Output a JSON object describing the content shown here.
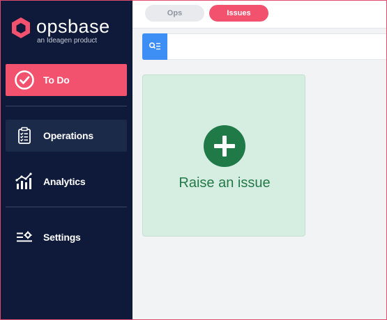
{
  "brand": {
    "name": "opsbase",
    "tagline": "an Ideagen product",
    "logo_icon": "hexagon-logo-icon",
    "accent": "#f2526e"
  },
  "sidebar": {
    "background": "#0f1a3a",
    "items": [
      {
        "label": "To Do",
        "icon": "check-circle-icon",
        "active": true
      },
      {
        "label": "Operations",
        "icon": "clipboard-list-icon",
        "active": false
      },
      {
        "label": "Analytics",
        "icon": "bar-chart-trend-icon",
        "active": false
      },
      {
        "label": "Settings",
        "icon": "settings-sliders-icon",
        "active": false
      }
    ]
  },
  "tabs": [
    {
      "label": "Ops",
      "selected": false
    },
    {
      "label": "Issues",
      "selected": true
    }
  ],
  "search": {
    "icon": "search-filter-icon",
    "value": "",
    "placeholder": ""
  },
  "card": {
    "label": "Raise an issue",
    "icon": "plus-circle-icon",
    "color": "#1f7a47"
  }
}
